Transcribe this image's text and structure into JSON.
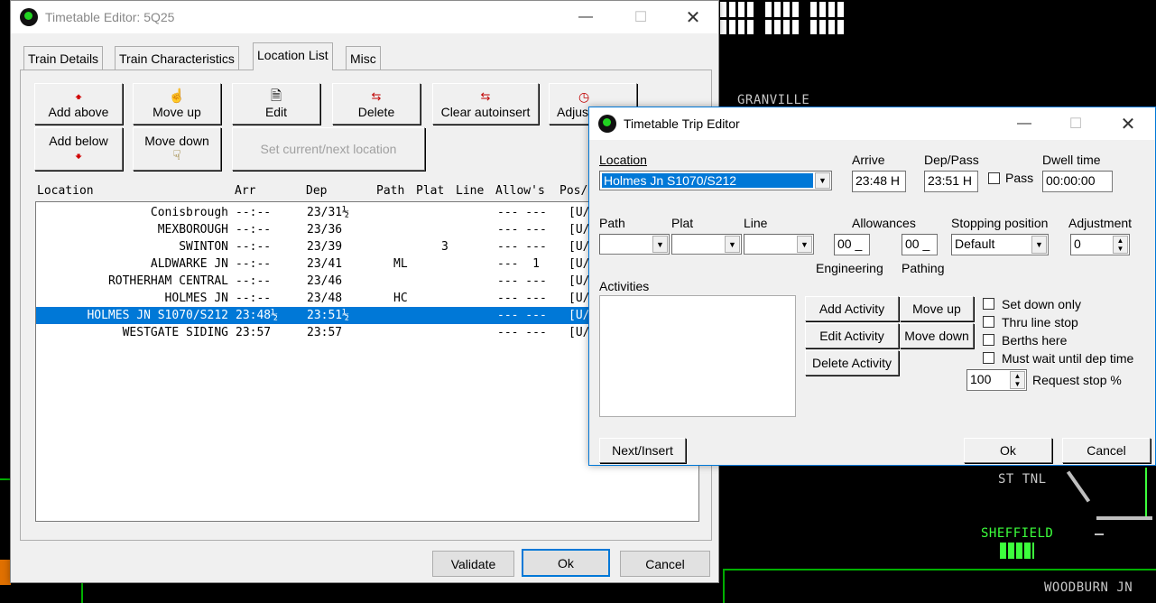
{
  "background": {
    "labels": [
      "GRANVILLE",
      "ST TNL",
      "SHEFFIELD",
      "WOODBURN JN"
    ]
  },
  "main_window": {
    "title": "Timetable Editor: 5Q25",
    "tabs": [
      "Train Details",
      "Train Characteristics",
      "Location List",
      "Misc"
    ],
    "buttons": {
      "add_above": "Add above",
      "add_below": "Add below",
      "move_up": "Move up",
      "move_down": "Move down",
      "edit": "Edit",
      "delete": "Delete",
      "clear_autoinsert": "Clear autoinsert",
      "adjust": "Adjus",
      "set_current": "Set current/next location"
    },
    "list_headers": [
      "Location",
      "Arr",
      "Dep",
      "Path",
      "Plat",
      "Line",
      "Allow's",
      "Pos/"
    ],
    "rows": [
      {
        "location": "Conisbrough",
        "arr": "--:--",
        "dep": "23/31½",
        "path": "",
        "plat": "",
        "line": "",
        "allow": "--- ---",
        "pos": "[U/"
      },
      {
        "location": "MEXBOROUGH",
        "arr": "--:--",
        "dep": "23/36",
        "path": "",
        "plat": "",
        "line": "",
        "allow": "--- ---",
        "pos": "[U/"
      },
      {
        "location": "SWINTON",
        "arr": "--:--",
        "dep": "23/39",
        "path": "",
        "plat": "3",
        "line": "",
        "allow": "--- ---",
        "pos": "[U/"
      },
      {
        "location": "ALDWARKE JN",
        "arr": "--:--",
        "dep": "23/41",
        "path": "ML",
        "plat": "",
        "line": "",
        "allow": "---  1",
        "pos": "[U/"
      },
      {
        "location": "ROTHERHAM CENTRAL",
        "arr": "--:--",
        "dep": "23/46",
        "path": "",
        "plat": "",
        "line": "",
        "allow": "--- ---",
        "pos": "[U/"
      },
      {
        "location": "HOLMES JN",
        "arr": "--:--",
        "dep": "23/48",
        "path": "HC",
        "plat": "",
        "line": "",
        "allow": "--- ---",
        "pos": "[U/"
      },
      {
        "location": "HOLMES JN S1070/S212",
        "arr": "23:48½",
        "dep": "23:51½",
        "path": "",
        "plat": "",
        "line": "",
        "allow": "--- ---",
        "pos": "[U/"
      },
      {
        "location": "WESTGATE SIDING",
        "arr": "23:57",
        "dep": "23:57",
        "path": "",
        "plat": "",
        "line": "",
        "allow": "--- ---",
        "pos": "[U/"
      }
    ],
    "selected_row": 6,
    "footer": {
      "validate": "Validate",
      "ok": "Ok",
      "cancel": "Cancel"
    }
  },
  "trip_editor": {
    "title": "Timetable Trip Editor",
    "location_label": "Location",
    "location_value": "Holmes Jn S1070/S212",
    "arrive_label": "Arrive",
    "arrive_value": "23:48 H",
    "dep_label": "Dep/Pass",
    "dep_value": "23:51 H",
    "pass_label": "Pass",
    "dwell_label": "Dwell time",
    "dwell_value": "00:00:00",
    "path_label": "Path",
    "plat_label": "Plat",
    "line_label": "Line",
    "allowances_label": "Allowances",
    "eng_value": "00 _",
    "path_allow_value": "00 _",
    "engineering_label": "Engineering",
    "pathing_label": "Pathing",
    "stopping_label": "Stopping position",
    "stopping_value": "Default",
    "adjustment_label": "Adjustment",
    "adjustment_value": "0",
    "activities_label": "Activities",
    "add_activity": "Add Activity",
    "edit_activity": "Edit Activity",
    "delete_activity": "Delete Activity",
    "move_up": "Move up",
    "move_down": "Move down",
    "set_down_only": "Set down only",
    "thru_line_stop": "Thru line stop",
    "berths_here": "Berths here",
    "must_wait": "Must wait until dep time",
    "request_stop_value": "100",
    "request_stop_label": "Request stop %",
    "next_insert": "Next/Insert",
    "ok": "Ok",
    "cancel": "Cancel"
  }
}
